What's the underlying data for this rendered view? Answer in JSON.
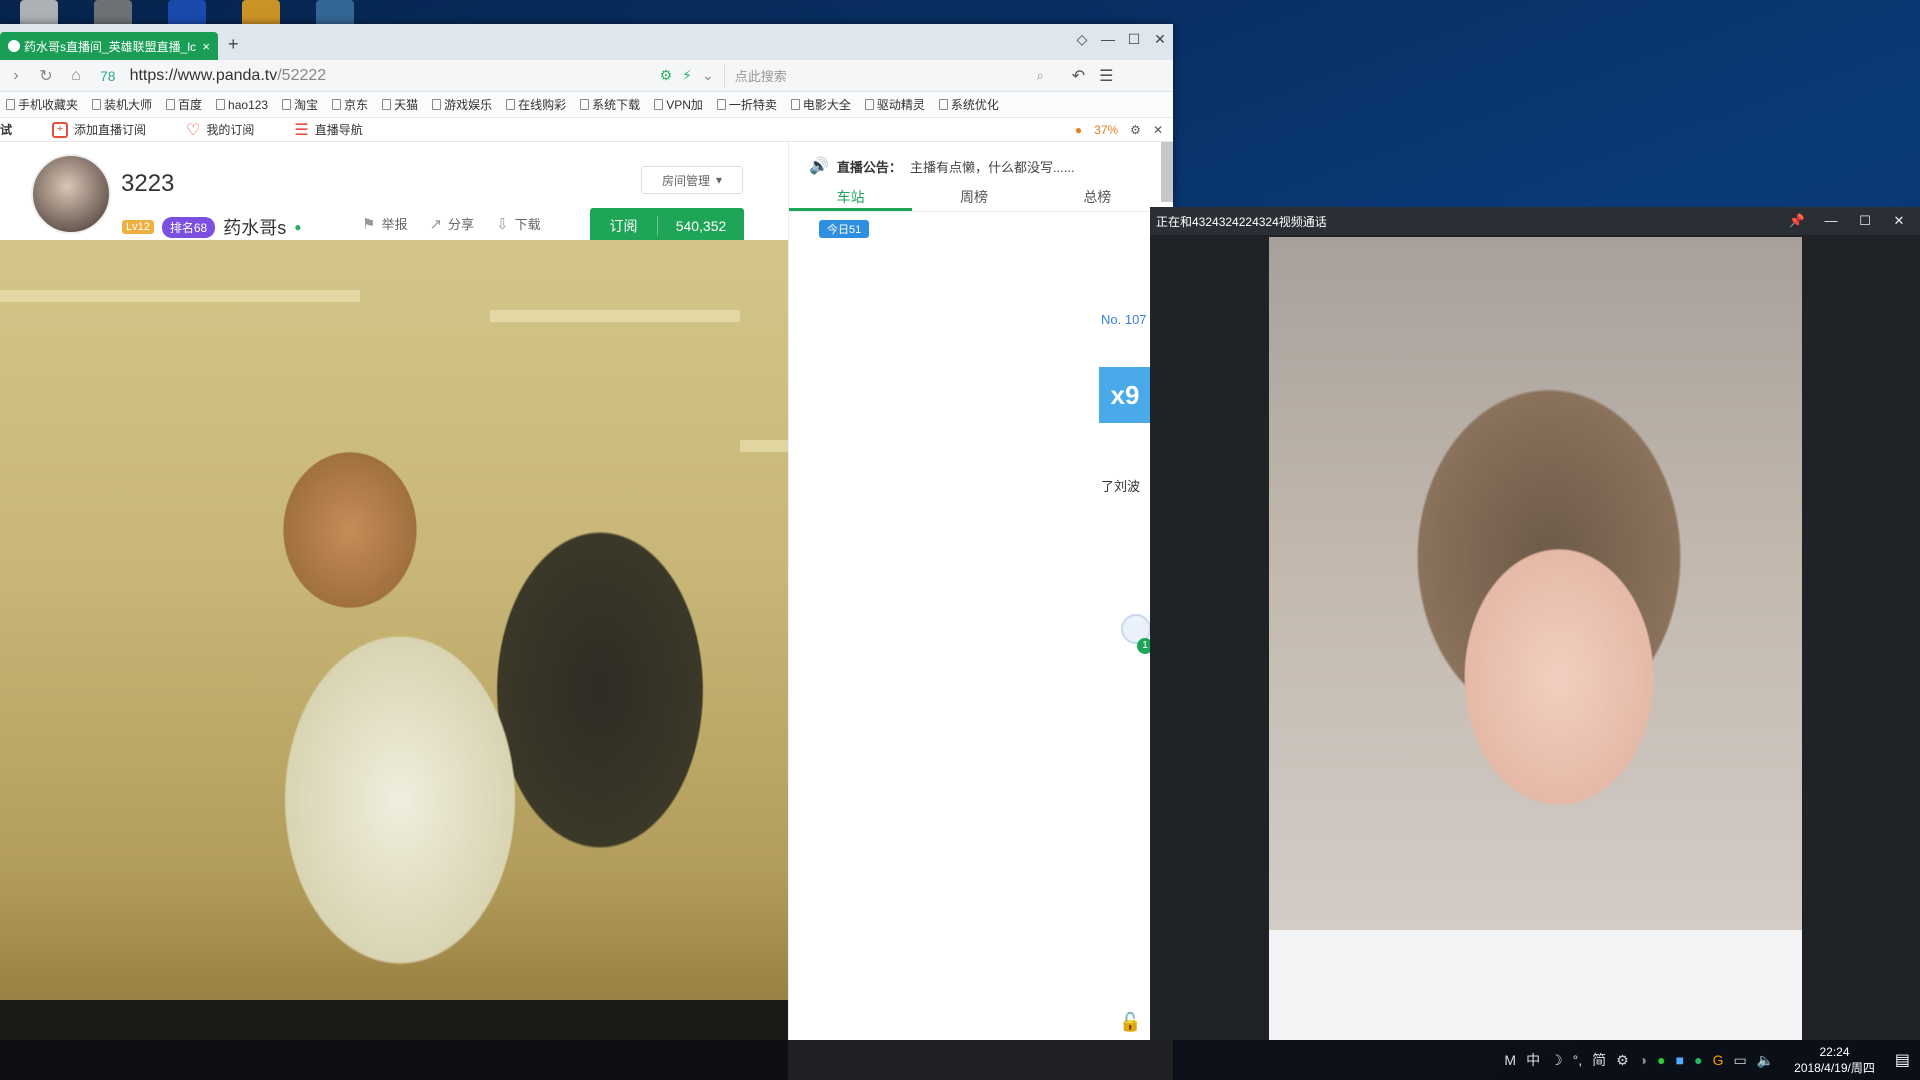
{
  "browser": {
    "tab_title": "药水哥s直播间_英雄联盟直播_lc",
    "tab_close": "×",
    "new_tab": "+",
    "window_controls": [
      "◇",
      "—",
      "☐",
      "✕"
    ],
    "address_number": "78",
    "url_host": "https://www.panda.tv",
    "url_path": "/52222",
    "search_placeholder": "点此搜索",
    "bookmarks": [
      "手机收藏夹",
      "装机大师",
      "百度",
      "hao123",
      "淘宝",
      "京东",
      "天猫",
      "游戏娱乐",
      "在线购彩",
      "系统下载",
      "VPN加",
      "一折特卖",
      "电影大全",
      "驱动精灵",
      "系统优化"
    ],
    "ext_bar": {
      "left_text": "试",
      "add_subscription": "添加直播订阅",
      "my_subscriptions": "我的订阅",
      "live_nav": "直播导航",
      "battery_pct": "37%"
    }
  },
  "room": {
    "room_id": "3223",
    "level": "Lv12",
    "rank": "排名68",
    "host_name": "药水哥s",
    "actions": [
      "举报",
      "分享",
      "下载"
    ],
    "room_mgmt": "房间管理",
    "subscribe_label": "订阅",
    "subscriber_count": "540,352"
  },
  "sidebar": {
    "notice_label": "直播公告：",
    "notice_text": "主播有点懒，什么都没写......",
    "tabs": [
      "车站",
      "周榜",
      "总榜"
    ],
    "today_pill": "今日51",
    "rank_no": "No. 107",
    "gift_multiplier": "x9",
    "chat_snippet": "了刘波",
    "badge_num": "1"
  },
  "call": {
    "title": "正在和4324324224324视频通话",
    "controls": [
      "📌",
      "—",
      "☐",
      "✕"
    ]
  },
  "taskbar": {
    "tray_items": [
      "M",
      "中",
      "☽",
      "°,",
      "简",
      "⚙"
    ],
    "time": "22:24",
    "date": "2018/4/19/周四"
  }
}
